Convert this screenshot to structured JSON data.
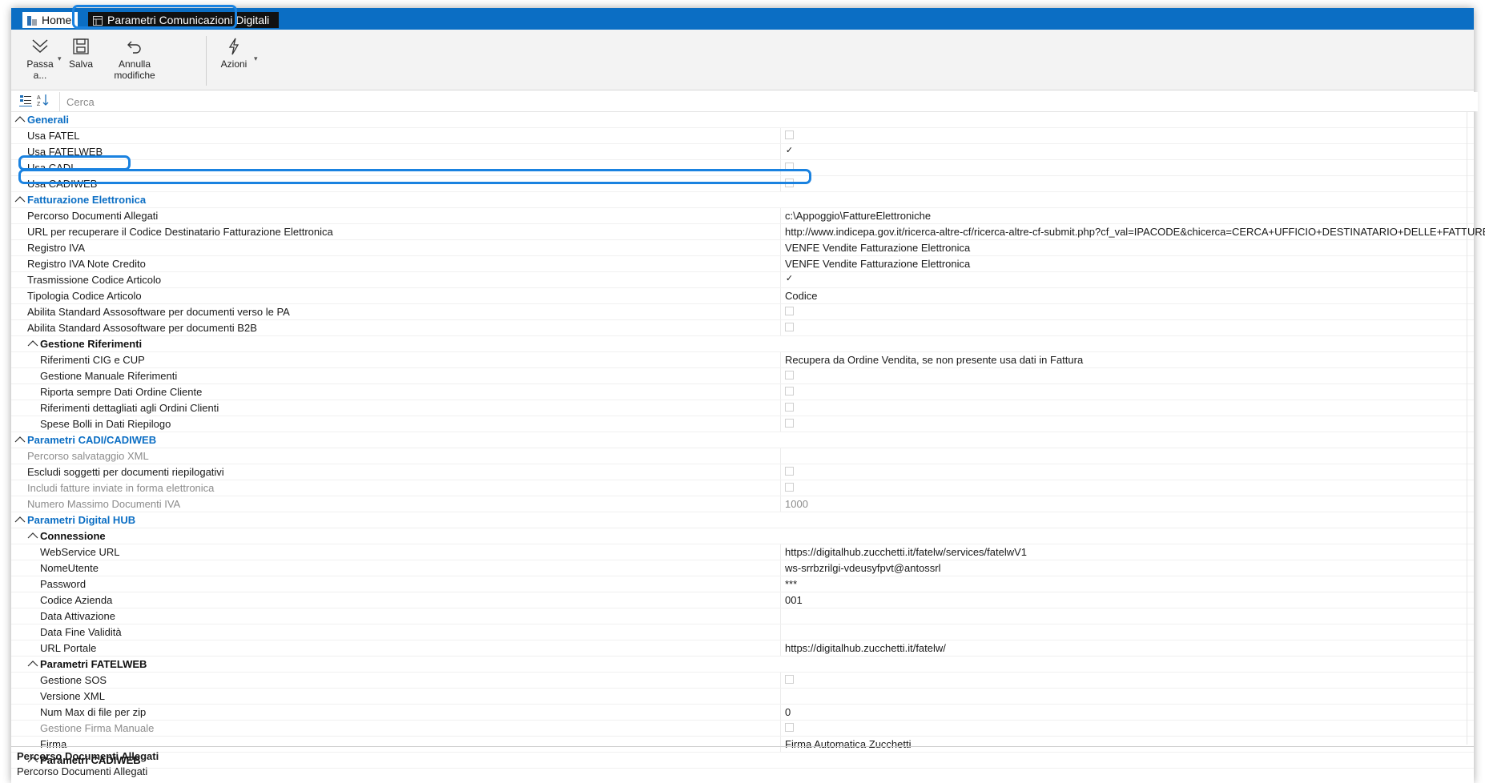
{
  "tabs": {
    "home": "Home",
    "active": "Parametri Comunicazioni Digitali"
  },
  "toolbar": {
    "passa_a": "Passa a...",
    "salva": "Salva",
    "annulla": "Annulla modifiche",
    "azioni": "Azioni"
  },
  "search": {
    "placeholder": "Cerca"
  },
  "rows": [
    {
      "type": "category",
      "level": 0,
      "label": "Generali"
    },
    {
      "type": "checkbox",
      "level": 1,
      "label": "Usa FATEL",
      "checked": false
    },
    {
      "type": "checkbox",
      "level": 1,
      "label": "Usa FATELWEB",
      "checked": true
    },
    {
      "type": "checkbox",
      "level": 1,
      "label": "Usa CADI",
      "checked": false
    },
    {
      "type": "checkbox",
      "level": 1,
      "label": "Usa CADIWEB",
      "checked": false
    },
    {
      "type": "category",
      "level": 0,
      "label": "Fatturazione Elettronica"
    },
    {
      "type": "text",
      "level": 1,
      "label": "Percorso Documenti Allegati",
      "value": "c:\\Appoggio\\FattureElettroniche"
    },
    {
      "type": "text",
      "level": 1,
      "label": "URL per recuperare il Codice Destinatario Fatturazione Elettronica",
      "value": "http://www.indicepa.gov.it/ricerca-altre-cf/ricerca-altre-cf-submit.php?cf_val=IPACODE&chicerca=CERCA+UFFICIO+DESTINATARIO+DELLE+FATTURE"
    },
    {
      "type": "text",
      "level": 1,
      "label": "Registro IVA",
      "value": "VENFE Vendite Fatturazione Elettronica"
    },
    {
      "type": "text",
      "level": 1,
      "label": "Registro IVA Note Credito",
      "value": "VENFE Vendite Fatturazione Elettronica"
    },
    {
      "type": "checkbox",
      "level": 1,
      "label": "Trasmissione Codice Articolo",
      "checked": true
    },
    {
      "type": "text",
      "level": 1,
      "label": "Tipologia Codice Articolo",
      "value": "Codice"
    },
    {
      "type": "checkbox",
      "level": 1,
      "label": "Abilita Standard Assosoftware per documenti verso le PA",
      "checked": false
    },
    {
      "type": "checkbox",
      "level": 1,
      "label": "Abilita Standard Assosoftware per documenti B2B",
      "checked": false
    },
    {
      "type": "subcategory",
      "level": 1,
      "label": "Gestione Riferimenti"
    },
    {
      "type": "text",
      "level": 2,
      "label": "Riferimenti CIG e CUP",
      "value": "Recupera da Ordine Vendita, se non presente usa dati in Fattura"
    },
    {
      "type": "checkbox",
      "level": 2,
      "label": "Gestione Manuale Riferimenti",
      "checked": false
    },
    {
      "type": "checkbox",
      "level": 2,
      "label": "Riporta sempre Dati Ordine Cliente",
      "checked": false
    },
    {
      "type": "checkbox",
      "level": 2,
      "label": "Riferimenti dettagliati agli Ordini Clienti",
      "checked": false
    },
    {
      "type": "checkbox",
      "level": 2,
      "label": "Spese Bolli in Dati Riepilogo",
      "checked": false
    },
    {
      "type": "category",
      "level": 0,
      "label": "Parametri CADI/CADIWEB"
    },
    {
      "type": "text",
      "level": 1,
      "label": "Percorso salvataggio XML",
      "value": "",
      "disabled": true
    },
    {
      "type": "checkbox",
      "level": 1,
      "label": "Escludi soggetti per documenti riepilogativi",
      "checked": false
    },
    {
      "type": "checkbox",
      "level": 1,
      "label": "Includi fatture inviate in forma elettronica",
      "checked": false,
      "disabled": true
    },
    {
      "type": "text",
      "level": 1,
      "label": "Numero Massimo Documenti IVA",
      "value": "1000",
      "disabled": true
    },
    {
      "type": "category",
      "level": 0,
      "label": "Parametri Digital HUB"
    },
    {
      "type": "subcategory",
      "level": 1,
      "label": "Connessione"
    },
    {
      "type": "text",
      "level": 2,
      "label": "WebService URL",
      "value": "https://digitalhub.zucchetti.it/fatelw/services/fatelwV1"
    },
    {
      "type": "text",
      "level": 2,
      "label": "NomeUtente",
      "value": "ws-srrbzrilgi-vdeusyfpvt@antossrl"
    },
    {
      "type": "text",
      "level": 2,
      "label": "Password",
      "value": "***"
    },
    {
      "type": "text",
      "level": 2,
      "label": "Codice Azienda",
      "value": "001"
    },
    {
      "type": "text",
      "level": 2,
      "label": "Data Attivazione",
      "value": ""
    },
    {
      "type": "text",
      "level": 2,
      "label": "Data Fine Validità",
      "value": ""
    },
    {
      "type": "text",
      "level": 2,
      "label": "URL Portale",
      "value": "https://digitalhub.zucchetti.it/fatelw/"
    },
    {
      "type": "subcategory",
      "level": 1,
      "label": "Parametri FATELWEB"
    },
    {
      "type": "checkbox",
      "level": 2,
      "label": "Gestione SOS",
      "checked": false
    },
    {
      "type": "text",
      "level": 2,
      "label": "Versione XML",
      "value": ""
    },
    {
      "type": "text",
      "level": 2,
      "label": "Num Max di file per zip",
      "value": "0"
    },
    {
      "type": "checkbox",
      "level": 2,
      "label": "Gestione Firma Manuale",
      "checked": false,
      "disabled": true
    },
    {
      "type": "text",
      "level": 2,
      "label": "Firma",
      "value": "Firma Automatica Zucchetti"
    },
    {
      "type": "subcategory",
      "level": 1,
      "label": "Parametri CADIWEB"
    }
  ],
  "description": {
    "title": "Percorso Documenti Allegati",
    "text": "Percorso Documenti Allegati"
  }
}
